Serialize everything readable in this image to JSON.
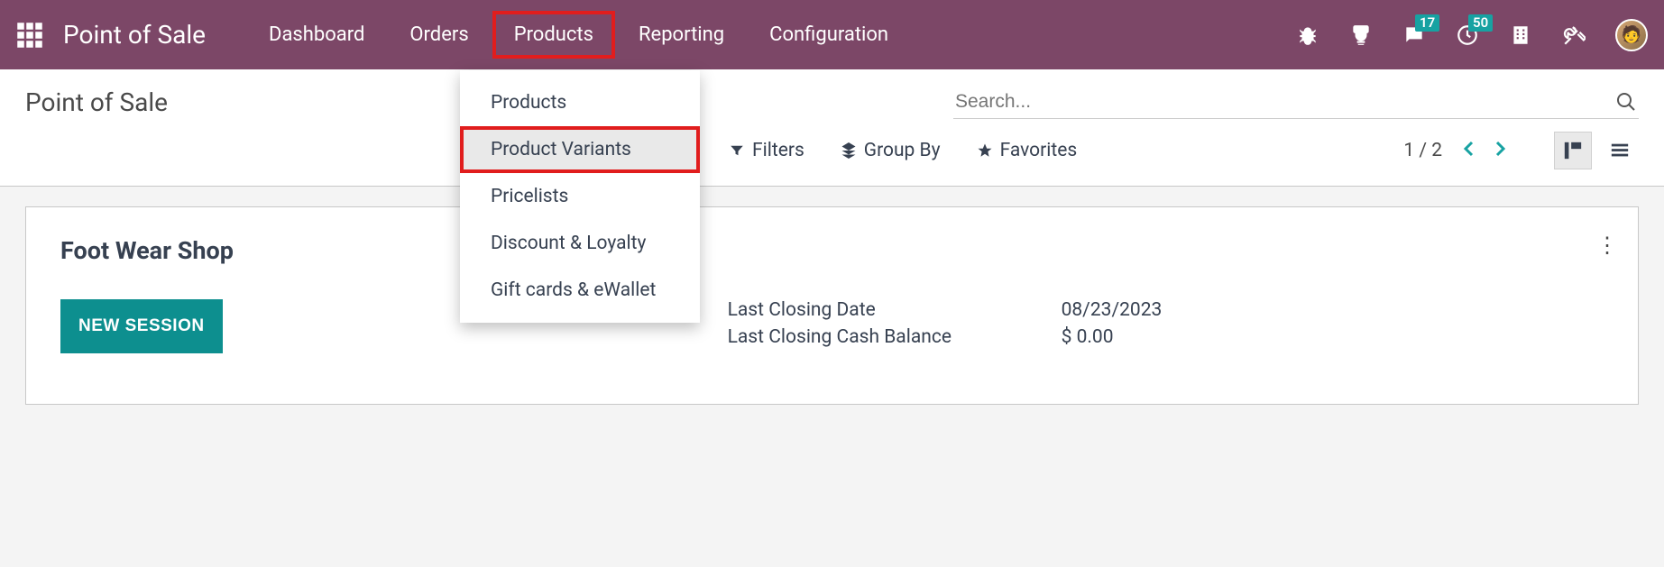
{
  "navbar": {
    "brand": "Point of Sale",
    "items": [
      "Dashboard",
      "Orders",
      "Products",
      "Reporting",
      "Configuration"
    ],
    "badges": {
      "chat": "17",
      "clock": "50"
    }
  },
  "dropdown": {
    "items": [
      "Products",
      "Product Variants",
      "Pricelists",
      "Discount & Loyalty",
      "Gift cards & eWallet"
    ]
  },
  "control": {
    "title": "Point of Sale",
    "search_placeholder": "Search...",
    "filters_label": "Filters",
    "groupby_label": "Group By",
    "favorites_label": "Favorites",
    "pager": "1 / 2"
  },
  "card": {
    "title": "Foot Wear Shop",
    "button": "NEW SESSION",
    "closing_date_label": "Last Closing Date",
    "closing_date_value": "08/23/2023",
    "closing_balance_label": "Last Closing Cash Balance",
    "closing_balance_value": "$ 0.00"
  }
}
